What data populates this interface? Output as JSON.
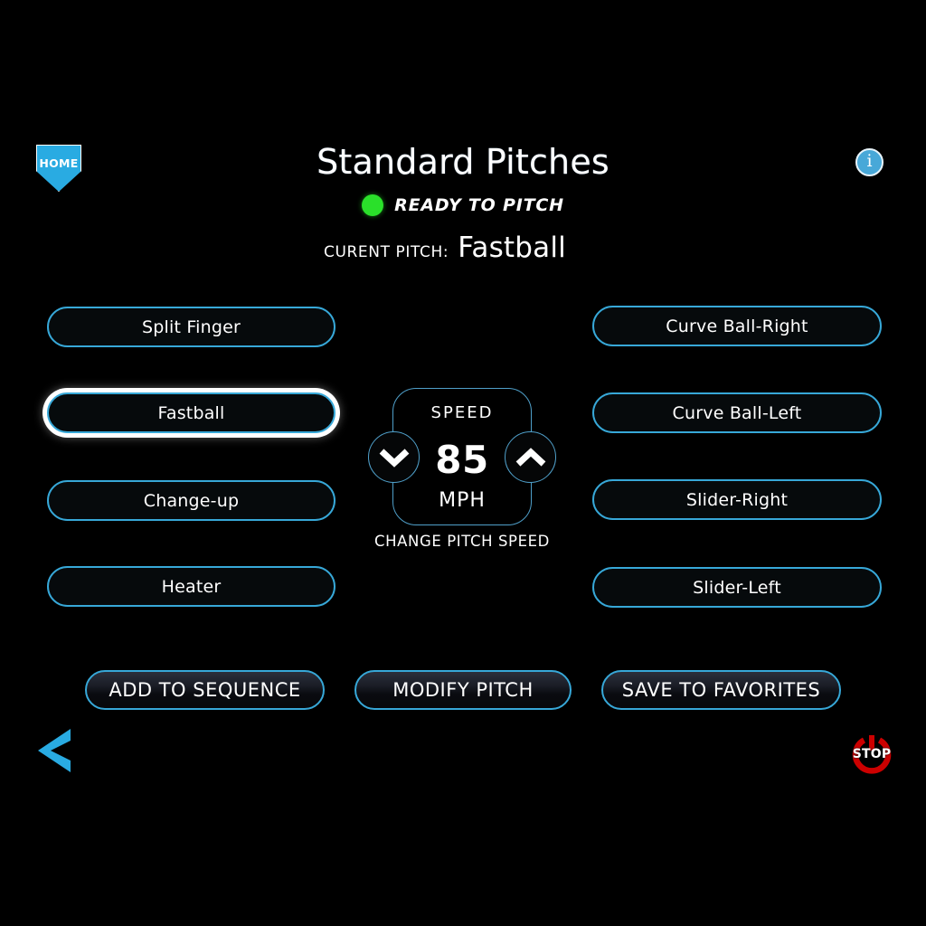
{
  "header": {
    "title": "Standard Pitches",
    "home_icon": "home-plate-icon",
    "home_label": "HOME",
    "info_icon": "info-icon",
    "info_glyph": "i"
  },
  "status": {
    "indicator_color": "#2ae02a",
    "text": "READY TO PITCH"
  },
  "current_pitch": {
    "label": "CURENT PITCH:",
    "value": "Fastball"
  },
  "pitch_buttons": {
    "left_column": [
      {
        "label": "Split Finger",
        "selected": false
      },
      {
        "label": "Fastball",
        "selected": true
      },
      {
        "label": "Change-up",
        "selected": false
      },
      {
        "label": "Heater",
        "selected": false
      }
    ],
    "right_column": [
      {
        "label": "Curve Ball-Right",
        "selected": false
      },
      {
        "label": "Curve Ball-Left",
        "selected": false
      },
      {
        "label": "Slider-Right",
        "selected": false
      },
      {
        "label": "Slider-Left",
        "selected": false
      }
    ]
  },
  "speed_control": {
    "label": "SPEED",
    "value": "85",
    "unit": "MPH",
    "caption": "CHANGE PITCH SPEED",
    "decrease_icon": "chevron-down-icon",
    "increase_icon": "chevron-up-icon"
  },
  "actions": [
    {
      "label": "ADD TO SEQUENCE"
    },
    {
      "label": "MODIFY PITCH"
    },
    {
      "label": "SAVE TO FAVORITES"
    }
  ],
  "footer": {
    "back_icon": "back-chevron-icon",
    "stop_icon": "power-stop-icon",
    "stop_label": "STOP"
  },
  "theme": {
    "background": "#000000",
    "accent": "#37a8d8",
    "accent_bright": "#29abe2",
    "status_green": "#2ae02a",
    "stop_red": "#cc0000",
    "text": "#ffffff"
  }
}
